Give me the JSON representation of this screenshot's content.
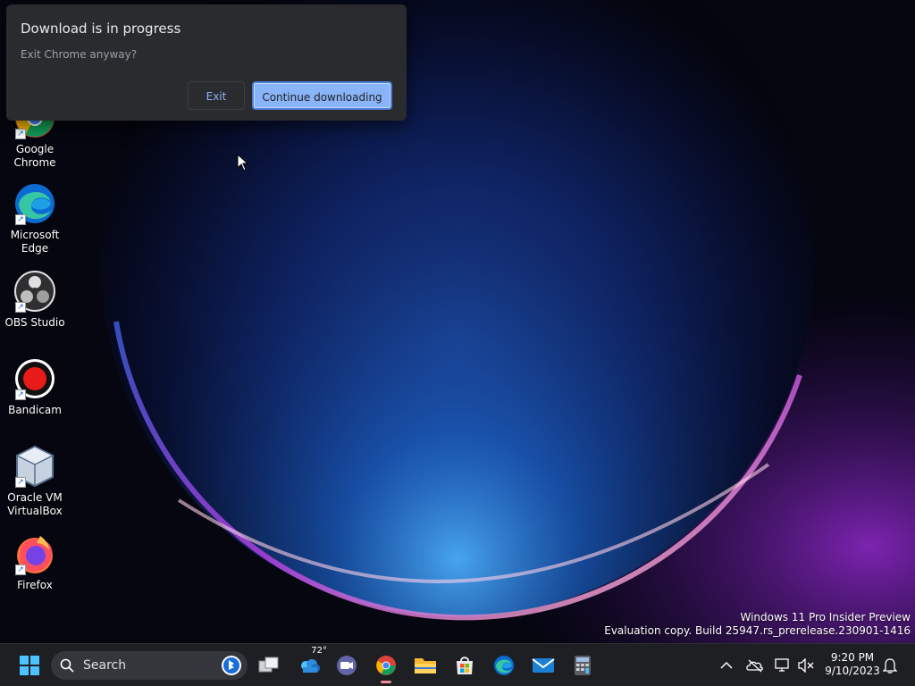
{
  "dialog": {
    "title": "Download is in progress",
    "message": "Exit Chrome anyway?",
    "exit_label": "Exit",
    "continue_label": "Continue downloading"
  },
  "desktop_icons": [
    {
      "label": "Google Chrome",
      "icon": "chrome-icon"
    },
    {
      "label": "Microsoft Edge",
      "icon": "edge-icon"
    },
    {
      "label": "OBS Studio",
      "icon": "obs-icon"
    },
    {
      "label": "Bandicam",
      "icon": "bandicam-icon"
    },
    {
      "label": "Oracle VM VirtualBox",
      "icon": "virtualbox-icon"
    },
    {
      "label": "Firefox",
      "icon": "firefox-icon"
    }
  ],
  "watermark": {
    "line1": "Windows 11 Pro Insider Preview",
    "line2": "Evaluation copy. Build 25947.rs_prerelease.230901-1416"
  },
  "taskbar": {
    "search_placeholder": "Search",
    "weather_temp": "72°",
    "clock_time": "9:20 PM",
    "clock_date": "9/10/2023",
    "apps": [
      "task-view",
      "widgets-weather",
      "teams-meet",
      "chrome",
      "file-explorer",
      "microsoft-store",
      "edge",
      "mail",
      "calculator"
    ]
  },
  "colors": {
    "accent": "#8ab4f8",
    "dialog_bg": "#2a2b2e",
    "taskbar_bg": "#1e1f23"
  }
}
